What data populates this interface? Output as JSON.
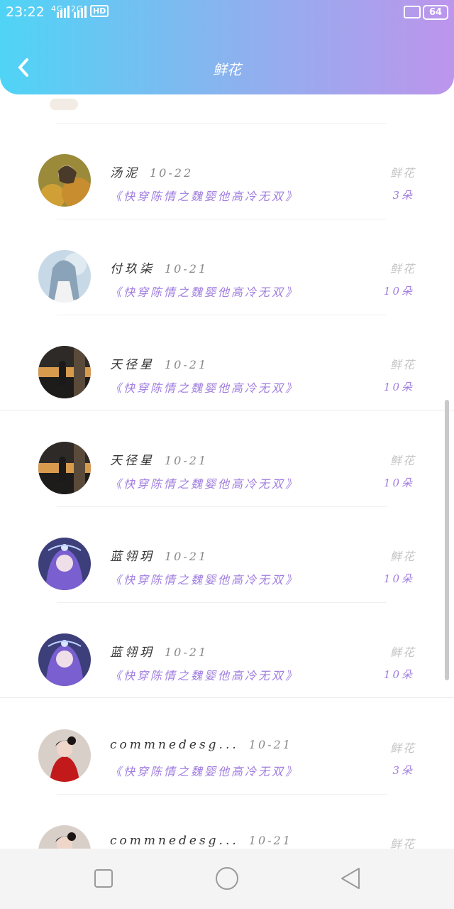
{
  "status_bar": {
    "time": "23:22",
    "network_4g": "4G",
    "network_2g": "2G",
    "hd": "HD",
    "battery": "64"
  },
  "header": {
    "title": "鲜花",
    "back_icon": "chevron-left-icon",
    "gradient": [
      "#4fd4f6",
      "#8fb0ee",
      "#bd95ec"
    ]
  },
  "list": {
    "items": [
      {
        "name": "汤泥",
        "date": "10-22",
        "book": "《快穿陈情之魏婴他高冷无双》",
        "flower_label": "鲜花",
        "flower_count": "3朵"
      },
      {
        "name": "付玖柒",
        "date": "10-21",
        "book": "《快穿陈情之魏婴他高冷无双》",
        "flower_label": "鲜花",
        "flower_count": "10朵"
      },
      {
        "name": "天径星",
        "date": "10-21",
        "book": "《快穿陈情之魏婴他高冷无双》",
        "flower_label": "鲜花",
        "flower_count": "10朵"
      },
      {
        "name": "天径星",
        "date": "10-21",
        "book": "《快穿陈情之魏婴他高冷无双》",
        "flower_label": "鲜花",
        "flower_count": "10朵"
      },
      {
        "name": "蓝翎玥",
        "date": "10-21",
        "book": "《快穿陈情之魏婴他高冷无双》",
        "flower_label": "鲜花",
        "flower_count": "10朵"
      },
      {
        "name": "蓝翎玥",
        "date": "10-21",
        "book": "《快穿陈情之魏婴他高冷无双》",
        "flower_label": "鲜花",
        "flower_count": "10朵"
      },
      {
        "name": "commnedesg...",
        "date": "10-21",
        "book": "《快穿陈情之魏婴他高冷无双》",
        "flower_label": "鲜花",
        "flower_count": "3朵"
      },
      {
        "name": "commnedesg...",
        "date": "10-21",
        "book": "",
        "flower_label": "鲜花",
        "flower_count": ""
      }
    ]
  },
  "nav_bar": {
    "recents_icon": "square-icon",
    "home_icon": "circle-icon",
    "back_icon": "triangle-back-icon"
  },
  "colors": {
    "accent_purple": "#a07de0",
    "muted_gray": "#c4c4c4"
  }
}
